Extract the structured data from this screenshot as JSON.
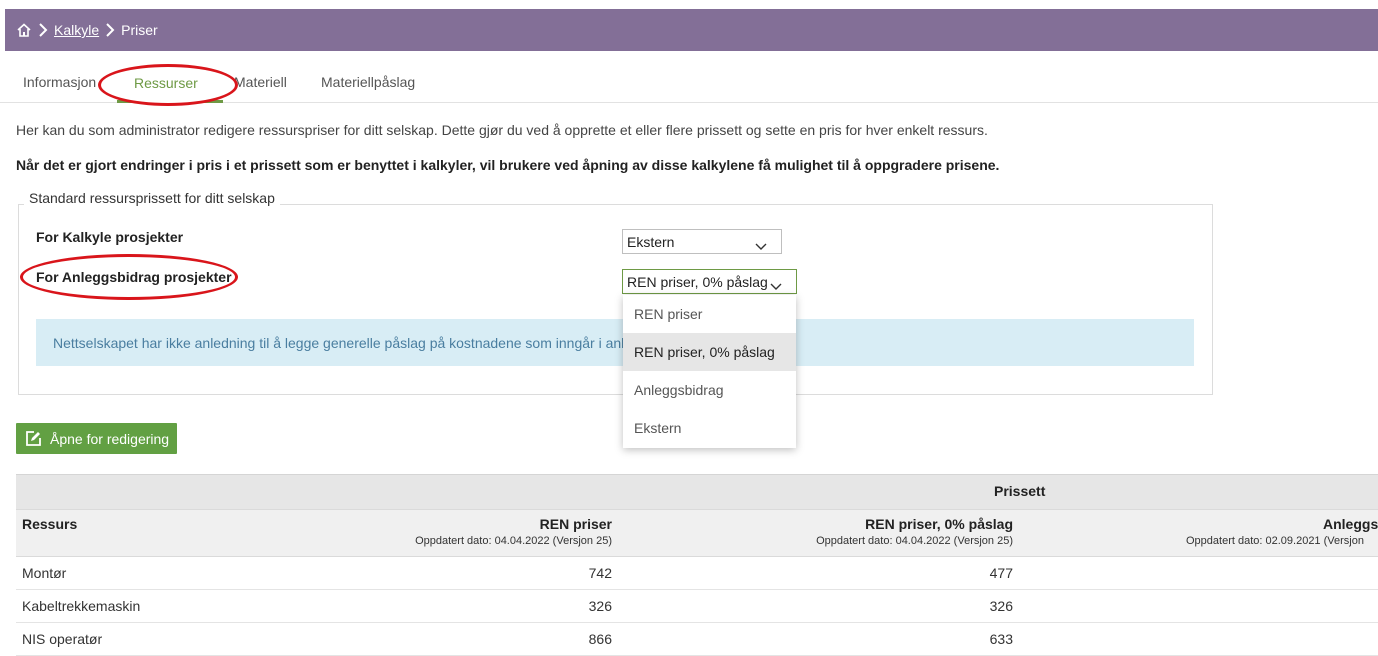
{
  "breadcrumb": {
    "home_icon": "home-icon",
    "kalkyle": "Kalkyle",
    "current": "Priser"
  },
  "tabs": [
    {
      "label": "Informasjon"
    },
    {
      "label": "Ressurser"
    },
    {
      "label": "Materiell"
    },
    {
      "label": "Materiellpåslag"
    }
  ],
  "intro": "Her kan du som administrator redigere ressurspriser for ditt selskap. Dette gjør du ved å opprette et eller flere prissett og sette en pris for hver enkelt ressurs.",
  "intro_bold": "Når det er gjort endringer i pris i et prissett som er benyttet i kalkyler, vil brukere ved åpning av disse kalkylene få mulighet til å oppgradere prisene.",
  "standard": {
    "legend": "Standard ressursprissett for ditt selskap",
    "kalkyle_label": "For Kalkyle prosjekter",
    "kalkyle_value": "Ekstern",
    "anlegg_label": "For Anleggsbidrag prosjekter",
    "anlegg_value": "REN priser, 0% påslag",
    "info": "Nettselskapet har ikke anledning til å legge generelle påslag på kostnadene som inngår i anl"
  },
  "dropdown": {
    "options": [
      "REN priser",
      "REN priser, 0% påslag",
      "Anleggsbidrag",
      "Ekstern"
    ],
    "selected": "REN priser, 0% påslag"
  },
  "edit_button": "Åpne for redigering",
  "table": {
    "group_header": "Prissett",
    "resource_header": "Ressurs",
    "columns": [
      {
        "name": "REN priser",
        "updated": "Oppdatert dato: 04.04.2022 (Versjon 25)"
      },
      {
        "name": "REN priser, 0% påslag",
        "updated": "Oppdatert dato: 04.04.2022 (Versjon 25)"
      },
      {
        "name": "Anleggsb",
        "updated": "Oppdatert dato: 02.09.2021 (Versjon"
      }
    ],
    "rows": [
      {
        "name": "Montør",
        "values": [
          "742",
          "477"
        ]
      },
      {
        "name": "Kabeltrekkemaskin",
        "values": [
          "326",
          "326"
        ]
      },
      {
        "name": "NIS operatør",
        "values": [
          "866",
          "633"
        ]
      }
    ]
  },
  "colors": {
    "header": "#836f97",
    "accent": "#6e9a45",
    "button": "#62a043",
    "annotation": "#d9151b"
  }
}
